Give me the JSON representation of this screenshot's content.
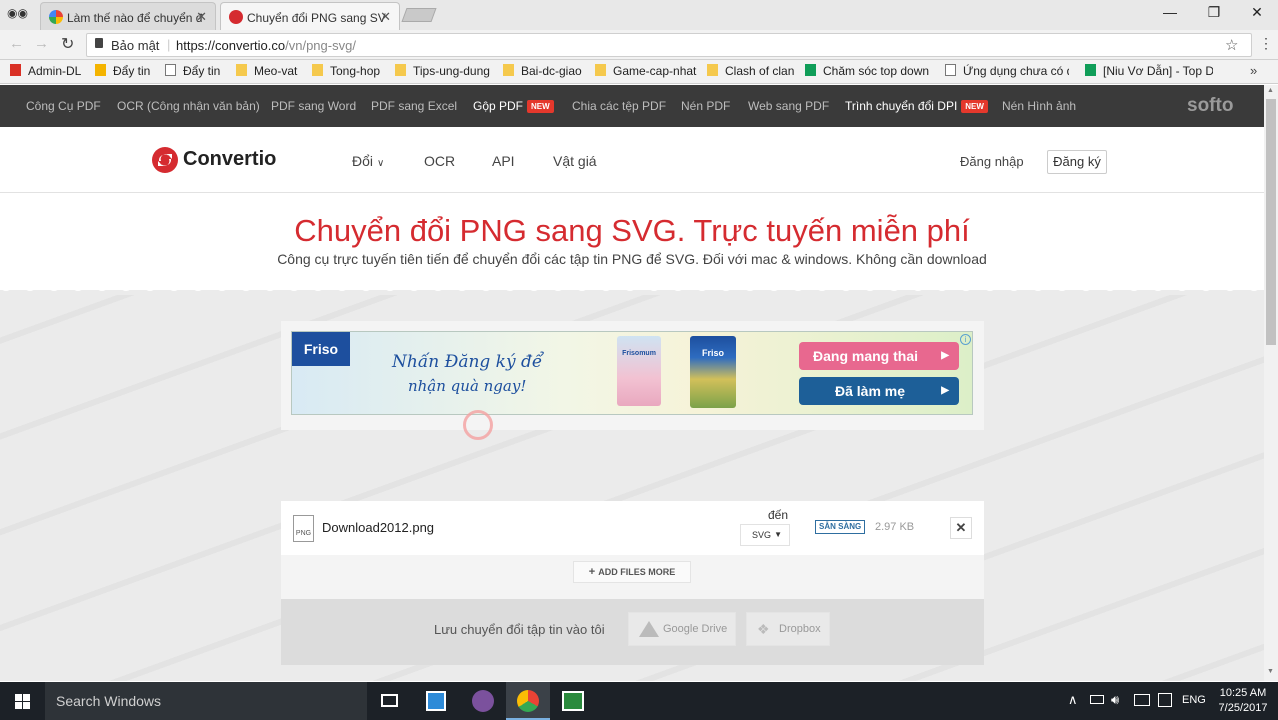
{
  "browser": {
    "tabs": [
      {
        "title": "Làm thế nào để chuyển đ"
      },
      {
        "title": "Chuyển đổi PNG sang SV"
      }
    ],
    "security_label": "Bảo mật",
    "url_base": "https://convertio.co",
    "url_path": "/vn/png-svg/"
  },
  "bookmarks": [
    {
      "label": "Admin-DL",
      "icon": "gmail-icon"
    },
    {
      "label": "Đẩy tin",
      "icon": "doc-icon"
    },
    {
      "label": "Đẩy tin",
      "icon": "page-icon"
    },
    {
      "label": "Meo-vat",
      "icon": "folder-icon"
    },
    {
      "label": "Tong-hop",
      "icon": "folder-icon"
    },
    {
      "label": "Tips-ung-dung",
      "icon": "folder-icon"
    },
    {
      "label": "Bai-dc-giao",
      "icon": "folder-icon"
    },
    {
      "label": "Game-cap-nhat",
      "icon": "folder-icon"
    },
    {
      "label": "Clash of clan",
      "icon": "folder-icon"
    },
    {
      "label": "Chăm sóc top down",
      "icon": "sheet-icon"
    },
    {
      "label": "Ứng dụng chưa có d",
      "icon": "page-icon"
    },
    {
      "label": "[Niu Vơ Dẫn] - Top D",
      "icon": "sheet-icon"
    }
  ],
  "softo": {
    "items": [
      {
        "label": "Công Cụ PDF"
      },
      {
        "label": "OCR (Công nhận văn bản)"
      },
      {
        "label": "PDF sang Word"
      },
      {
        "label": "PDF sang Excel"
      },
      {
        "label": "Gộp PDF",
        "badge": "NEW"
      },
      {
        "label": "Chia các tệp PDF"
      },
      {
        "label": "Nén PDF"
      },
      {
        "label": "Web sang PDF"
      },
      {
        "label": "Trình chuyển đổi DPI",
        "badge": "NEW"
      },
      {
        "label": "Nén Hình ảnh"
      }
    ],
    "logo": "softo"
  },
  "site": {
    "logo": "Convertio",
    "nav": [
      "Đổi",
      "OCR",
      "API",
      "Vật giá"
    ],
    "login": "Đăng nhập",
    "signup": "Đăng ký"
  },
  "hero": {
    "title": "Chuyển đổi PNG sang SVG. Trực tuyến miễn phí",
    "subtitle": "Công cụ trực tuyến tiên tiến để chuyển đổi các tập tin PNG để SVG. Đối với mac & windows. Không cần download"
  },
  "ad": {
    "brand": "Friso",
    "text_line1": "Nhấn Đăng ký để",
    "text_line2": "nhận quà ngay!",
    "product1": "Frisomum",
    "product2": "Friso",
    "button1": "Đang mang thai",
    "button2": "Đã làm mẹ"
  },
  "converter": {
    "file_name": "Download2012.png",
    "to_label": "đến",
    "format": "SVG",
    "status": "SẴN SÀNG",
    "size": "2.97 KB",
    "add_more": "ADD FILES MORE",
    "save_label": "Lưu chuyển đổi tập tin vào tôi",
    "gdrive": "Google Drive",
    "dropbox": "Dropbox"
  },
  "taskbar": {
    "search_placeholder": "Search Windows",
    "lang": "ENG",
    "time": "10:25 AM",
    "date": "7/25/2017"
  },
  "colors": {
    "accent_red": "#d52b30",
    "softo_bar": "#3a3a3a",
    "status_blue": "#2e6ea0"
  }
}
